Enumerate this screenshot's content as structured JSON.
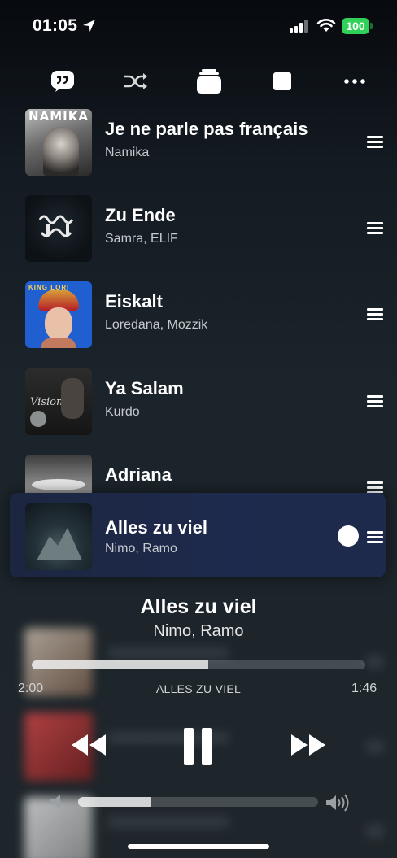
{
  "status_bar": {
    "time": "01:05",
    "battery": "100"
  },
  "toolbar": {
    "lyrics": "lyrics-bubble-icon",
    "shuffle": "shuffle-icon",
    "queue": "queue-stack-icon",
    "stop": "stop-icon",
    "more": "ellipsis-icon"
  },
  "queue": [
    {
      "title": "Je ne parle pas français",
      "artist": "Namika",
      "art_label": "NAMIKA"
    },
    {
      "title": "Zu Ende",
      "artist": "Samra, ELIF"
    },
    {
      "title": "Eiskalt",
      "artist": "Loredana, Mozzik",
      "art_label": "KING LORI"
    },
    {
      "title": "Ya Salam",
      "artist": "Kurdo",
      "art_label": "Vision"
    },
    {
      "title": "Adriana",
      "artist": ""
    }
  ],
  "dragging": {
    "title": "Alles zu viel",
    "artist": "Nimo, Ramo"
  },
  "now_playing": {
    "title": "Alles zu viel",
    "artist": "Nimo, Ramo",
    "caption": "ALLES ZU VIEL",
    "elapsed": "2:00",
    "remaining": "1:46",
    "progress_percent": 53,
    "volume_percent": 30
  },
  "colors": {
    "accent_battery": "#30d158",
    "drag_highlight": "#1e2a4d"
  }
}
